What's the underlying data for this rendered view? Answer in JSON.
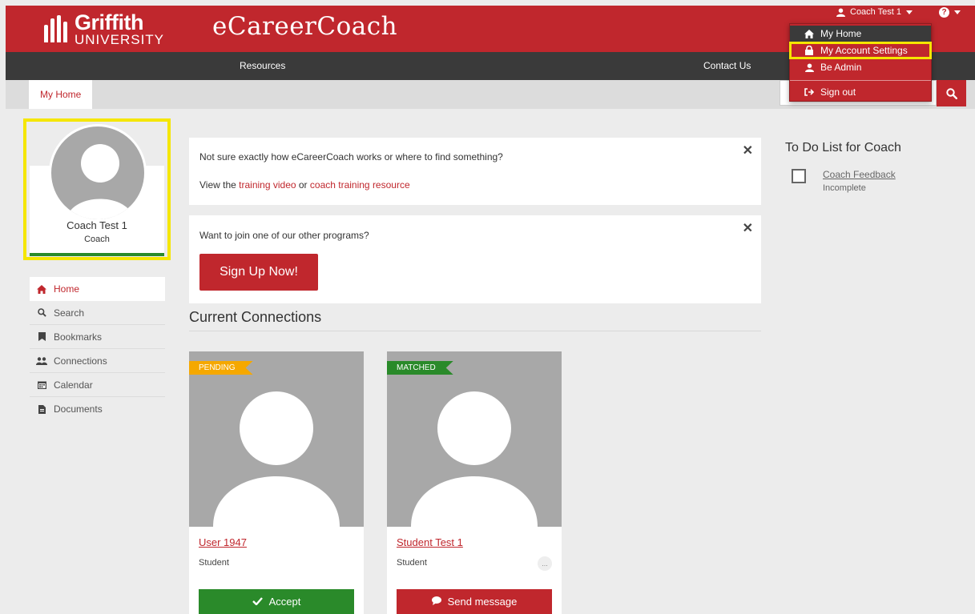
{
  "header": {
    "logo_name": "Griffith",
    "logo_sub": "UNIVERSITY",
    "app_title": "eCareerCoach",
    "user_label": "Coach Test 1",
    "help_icon": "question-circle-icon",
    "brand_color": "#c0272d"
  },
  "nav": {
    "resources": "Resources",
    "contact": "Contact Us"
  },
  "tabs": {
    "my_home": "My Home"
  },
  "dropdown": {
    "items": [
      {
        "label": "My Home",
        "icon": "home-icon"
      },
      {
        "label": "My Account Settings",
        "icon": "lock-icon"
      },
      {
        "label": "Be Admin",
        "icon": "user-icon"
      },
      {
        "label": "Sign out",
        "icon": "sign-out-icon"
      }
    ]
  },
  "profile": {
    "name": "Coach Test 1",
    "role": "Coach"
  },
  "sidebar": {
    "items": [
      {
        "label": "Home",
        "icon": "home-icon"
      },
      {
        "label": "Search",
        "icon": "search-icon"
      },
      {
        "label": "Bookmarks",
        "icon": "bookmark-icon"
      },
      {
        "label": "Connections",
        "icon": "users-icon"
      },
      {
        "label": "Calendar",
        "icon": "calendar-icon"
      },
      {
        "label": "Documents",
        "icon": "document-icon"
      }
    ]
  },
  "notices": {
    "training_question": "Not sure exactly how eCareerCoach works or where to find something?",
    "view_prefix": "View the ",
    "training_video": "training video",
    "or_text": " or ",
    "coach_resource": "coach training resource",
    "join_question": "Want to join one of our other programs?",
    "signup_label": "Sign Up Now!"
  },
  "connections": {
    "title": "Current Connections",
    "cards": [
      {
        "status": "PENDING",
        "status_color": "#f5a800",
        "name": "User 1947",
        "role": "Student",
        "action": "Accept",
        "action_color": "#2a8a2a"
      },
      {
        "status": "MATCHED",
        "status_color": "#2a8a2a",
        "name": "Student Test 1",
        "role": "Student",
        "more": "...",
        "action": "Send message",
        "action_color": "#c0272d"
      }
    ]
  },
  "todo": {
    "title": "To Do List for Coach",
    "items": [
      {
        "label": "Coach Feedback",
        "status": "Incomplete"
      }
    ]
  }
}
